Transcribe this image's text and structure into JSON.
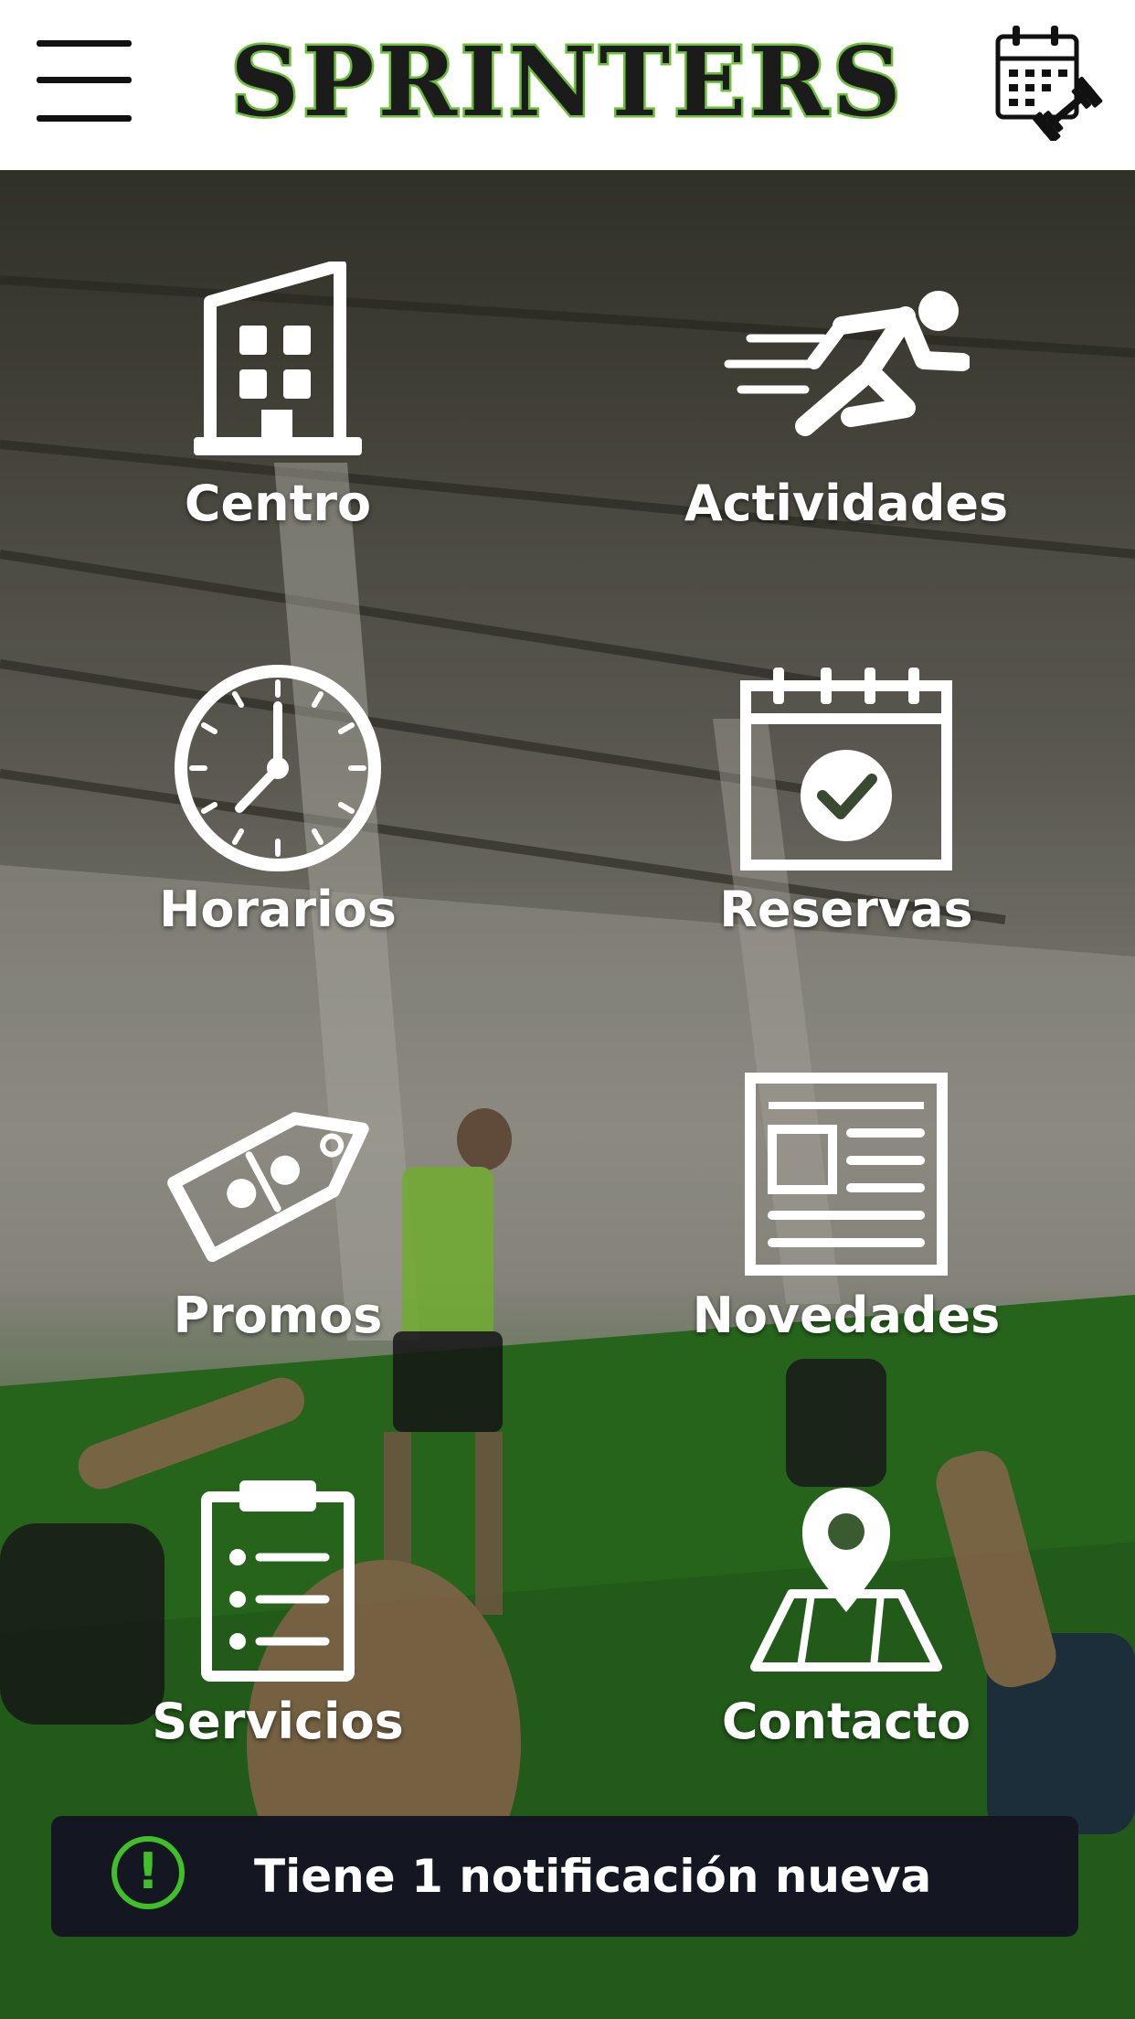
{
  "app": {
    "title": "SPRINTERS"
  },
  "header": {
    "menu_icon": "hamburger-menu-icon",
    "calendar_icon": "calendar-dumbbell-icon"
  },
  "menu": {
    "items": [
      {
        "label": "Centro",
        "icon": "building-icon"
      },
      {
        "label": "Actividades",
        "icon": "runner-icon"
      },
      {
        "label": "Horarios",
        "icon": "clock-icon"
      },
      {
        "label": "Reservas",
        "icon": "calendar-check-icon"
      },
      {
        "label": "Promos",
        "icon": "discount-tag-icon"
      },
      {
        "label": "Novedades",
        "icon": "newspaper-icon"
      },
      {
        "label": "Servicios",
        "icon": "clipboard-list-icon"
      },
      {
        "label": "Contacto",
        "icon": "map-pin-icon"
      }
    ]
  },
  "notification": {
    "icon": "exclamation-circle-icon",
    "text": "Tiene 1 notificación nueva"
  },
  "colors": {
    "accent": "#6bbf38",
    "notification_bg": "#141722",
    "notification_icon": "#3fbf28"
  }
}
